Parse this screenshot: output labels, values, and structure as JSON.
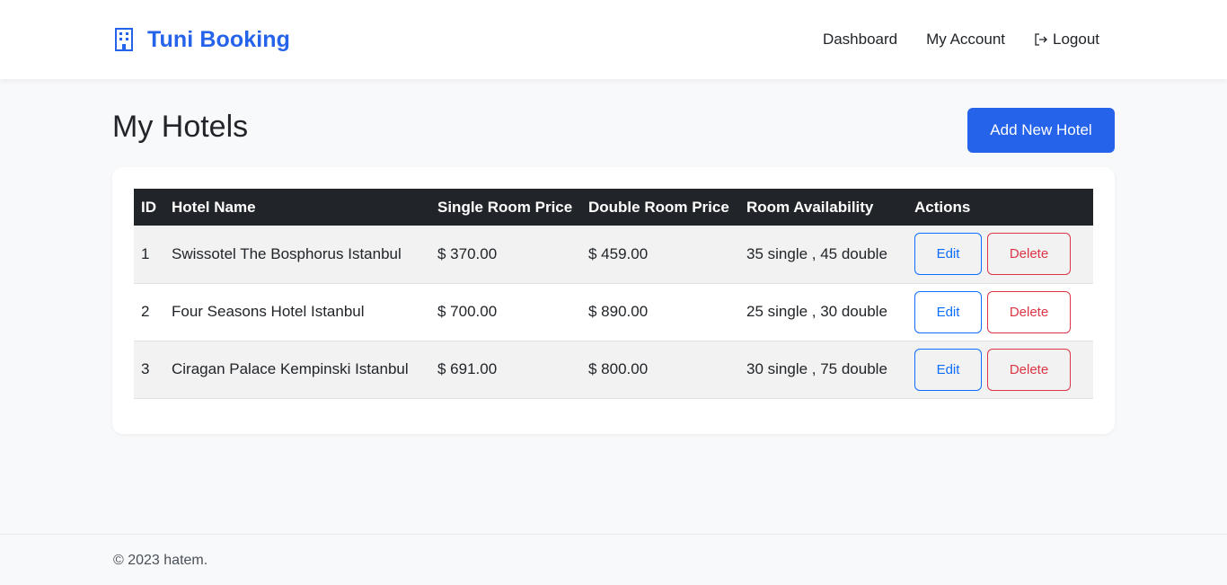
{
  "brand": {
    "name": "Tuni Booking",
    "icon": "building-icon",
    "color": "#2563eb"
  },
  "nav": {
    "dashboard": "Dashboard",
    "account": "My Account",
    "logout": "Logout"
  },
  "page": {
    "title": "My Hotels",
    "add_button": "Add New Hotel"
  },
  "table": {
    "headers": [
      "ID",
      "Hotel Name",
      "Single Room Price",
      "Double Room Price",
      "Room Availability",
      "Actions"
    ],
    "rows": [
      {
        "id": "1",
        "name": "Swissotel The Bosphorus Istanbul",
        "single": "$ 370.00",
        "double": "$ 459.00",
        "availability": "35 single , 45 double"
      },
      {
        "id": "2",
        "name": "Four Seasons Hotel Istanbul",
        "single": "$ 700.00",
        "double": "$ 890.00",
        "availability": "25 single , 30 double"
      },
      {
        "id": "3",
        "name": "Ciragan Palace Kempinski Istanbul",
        "single": "$ 691.00",
        "double": "$ 800.00",
        "availability": "30 single , 75 double"
      }
    ],
    "edit_label": "Edit",
    "delete_label": "Delete"
  },
  "footer": {
    "text": "© 2023 hatem."
  },
  "colors": {
    "primary": "#2563eb",
    "edit": "#0d6efd",
    "delete": "#dc3545",
    "header_bg": "#212529"
  }
}
